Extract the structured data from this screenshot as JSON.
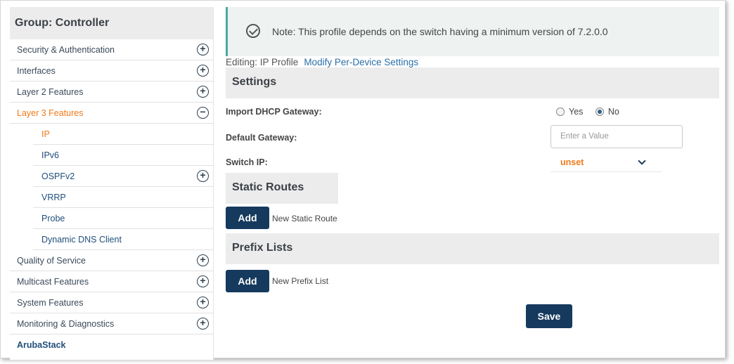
{
  "sidebar": {
    "title": "Group: Controller",
    "items": [
      {
        "label": "Security & Authentication",
        "toggle": "+"
      },
      {
        "label": "Interfaces",
        "toggle": "+"
      },
      {
        "label": "Layer 2 Features",
        "toggle": "+"
      },
      {
        "label": "Layer 3 Features",
        "toggle": "−"
      },
      {
        "label": "IP"
      },
      {
        "label": "IPv6"
      },
      {
        "label": "OSPFv2",
        "toggle": "+"
      },
      {
        "label": "VRRP"
      },
      {
        "label": "Probe"
      },
      {
        "label": "Dynamic DNS Client"
      },
      {
        "label": "Quality of Service",
        "toggle": "+"
      },
      {
        "label": "Multicast Features",
        "toggle": "+"
      },
      {
        "label": "System Features",
        "toggle": "+"
      },
      {
        "label": "Monitoring & Diagnostics",
        "toggle": "+"
      },
      {
        "label": "ArubaStack"
      }
    ]
  },
  "note": {
    "text": "Note: This profile depends on the switch having a minimum version of 7.2.0.0"
  },
  "editing": {
    "label": "Editing: IP Profile",
    "link": "Modify Per-Device Settings"
  },
  "settings": {
    "title": "Settings",
    "import_dhcp_label": "Import DHCP Gateway:",
    "yes_label": "Yes",
    "no_label": "No",
    "default_gateway_label": "Default Gateway:",
    "default_gateway_placeholder": "Enter a Value",
    "switch_ip_label": "Switch IP:",
    "switch_ip_value": "unset"
  },
  "static_routes": {
    "title": "Static Routes",
    "add_label": "Add",
    "hint": "New Static Route"
  },
  "prefix_lists": {
    "title": "Prefix Lists",
    "add_label": "Add",
    "hint": "New Prefix List"
  },
  "save_label": "Save",
  "colors": {
    "accent": "#f07a1a",
    "button": "#153a5e",
    "note_border": "#4fa7a0"
  }
}
